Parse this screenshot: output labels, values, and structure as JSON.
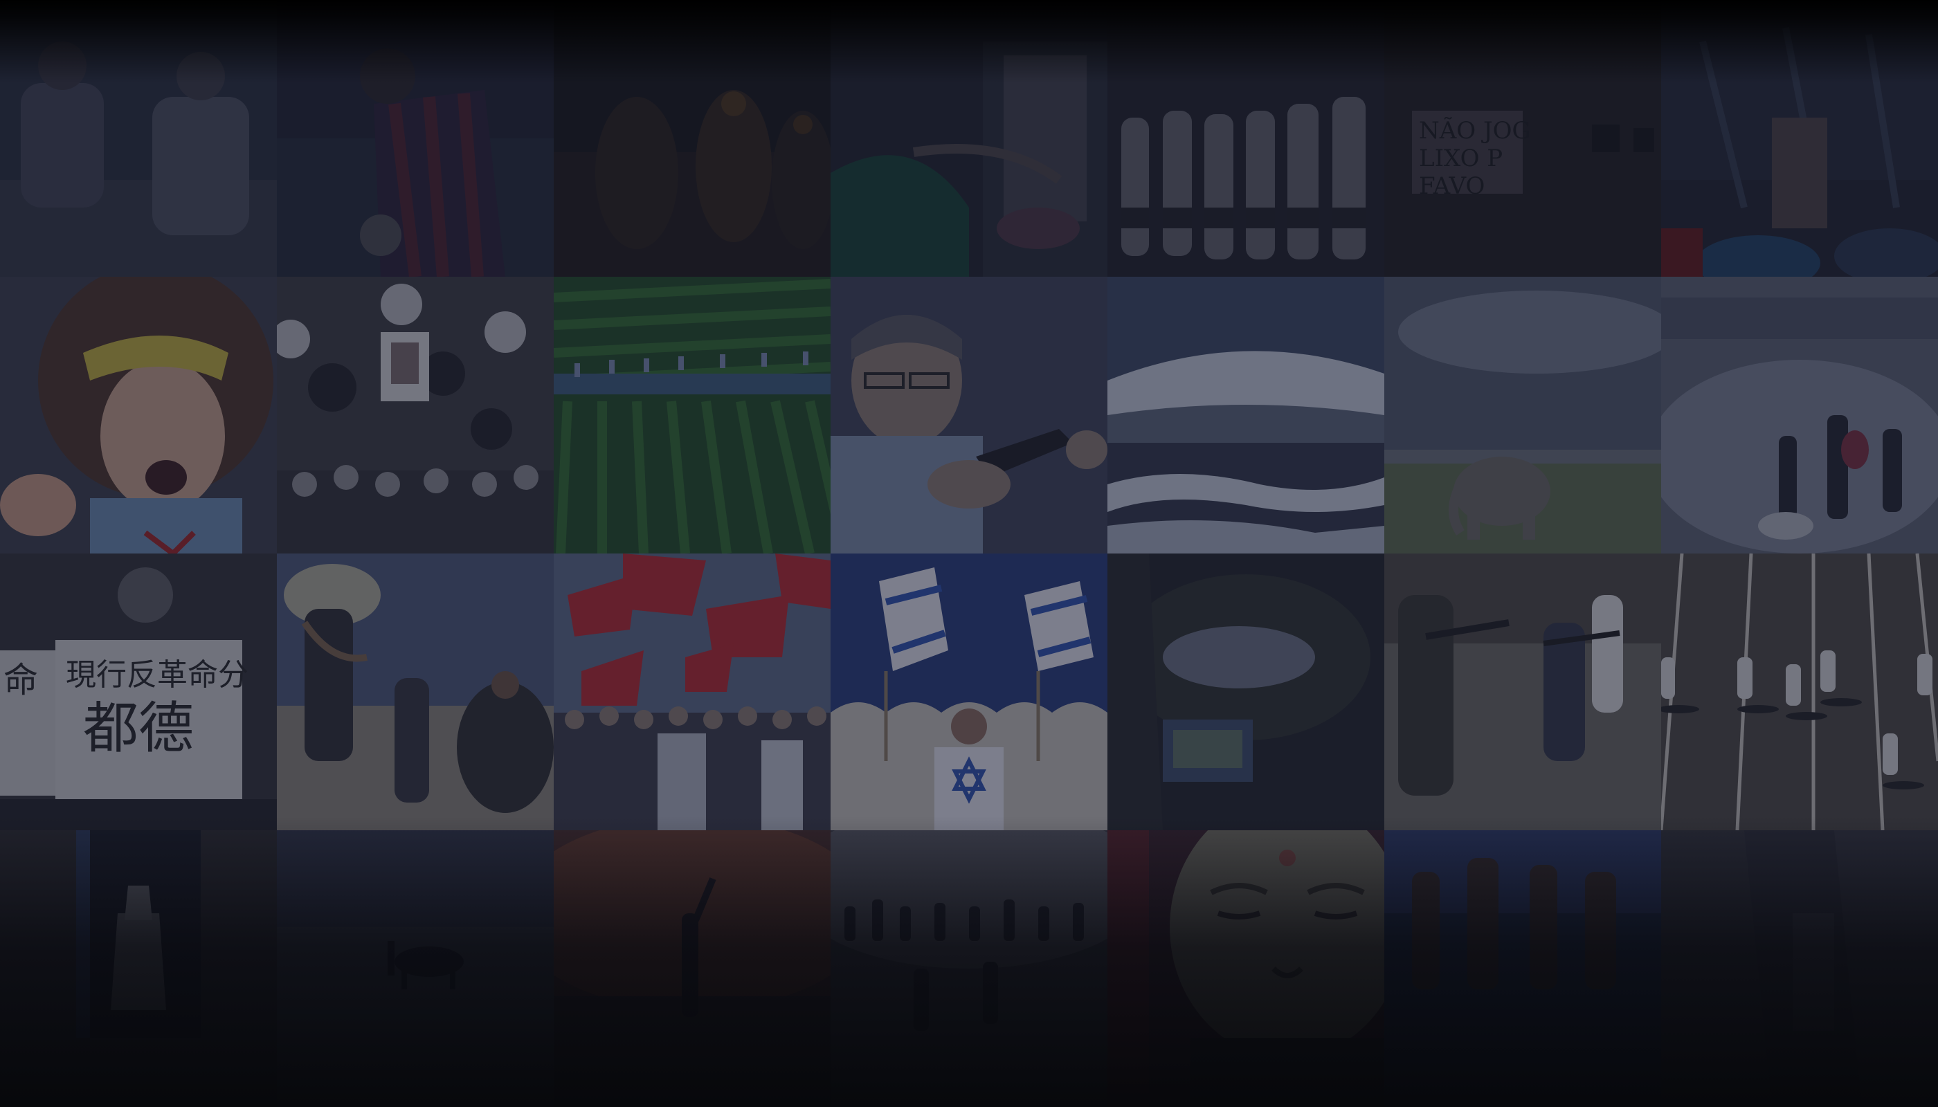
{
  "gallery": {
    "photos": [
      {
        "subject": "young men walking outdoors"
      },
      {
        "subject": "football player in striped jersey"
      },
      {
        "subject": "crowd at night"
      },
      {
        "subject": "woman in green dress"
      },
      {
        "subject": "line of shirtless men"
      },
      {
        "subject": "graffiti wall with painted text"
      },
      {
        "subject": "cluttered market stall"
      },
      {
        "subject": "young protester shouting with headband"
      },
      {
        "subject": "crowd with balloons and portrait"
      },
      {
        "subject": "aerial view of green field rows"
      },
      {
        "subject": "man at microphone"
      },
      {
        "subject": "snow-covered volcano landscape"
      },
      {
        "subject": "elephant on grass field"
      },
      {
        "subject": "protesters in tear gas smoke"
      },
      {
        "subject": "boy holding placards"
      },
      {
        "subject": "women carrying bundles in dust"
      },
      {
        "subject": "crowd with red flags"
      },
      {
        "subject": "man holding Israeli flags"
      },
      {
        "subject": "landscape painting"
      },
      {
        "subject": "armed men on sandy street"
      },
      {
        "subject": "runners on a track"
      },
      {
        "subject": "figure in a doorway"
      },
      {
        "subject": "silhouettes in misty field"
      },
      {
        "subject": "silhouette against sunset"
      },
      {
        "subject": "group walking in fog"
      },
      {
        "subject": "golden Buddha face"
      },
      {
        "subject": "dancers in blue light"
      },
      {
        "subject": "dark interior"
      }
    ],
    "visible_text": {
      "graffiti_sign": [
        "NÃO JOG",
        "LIXO P",
        "FAVO"
      ],
      "placard_left": "命",
      "placard_right_top": "現行反革命分",
      "placard_right_bottom": "都德"
    },
    "colors": {
      "backdrop": "#0a0b10",
      "overlay_tint": "#1a1f33",
      "flag_red": "#b8252a",
      "field_green": "#2f6b2a",
      "flag_blue": "#2a50b0"
    }
  }
}
